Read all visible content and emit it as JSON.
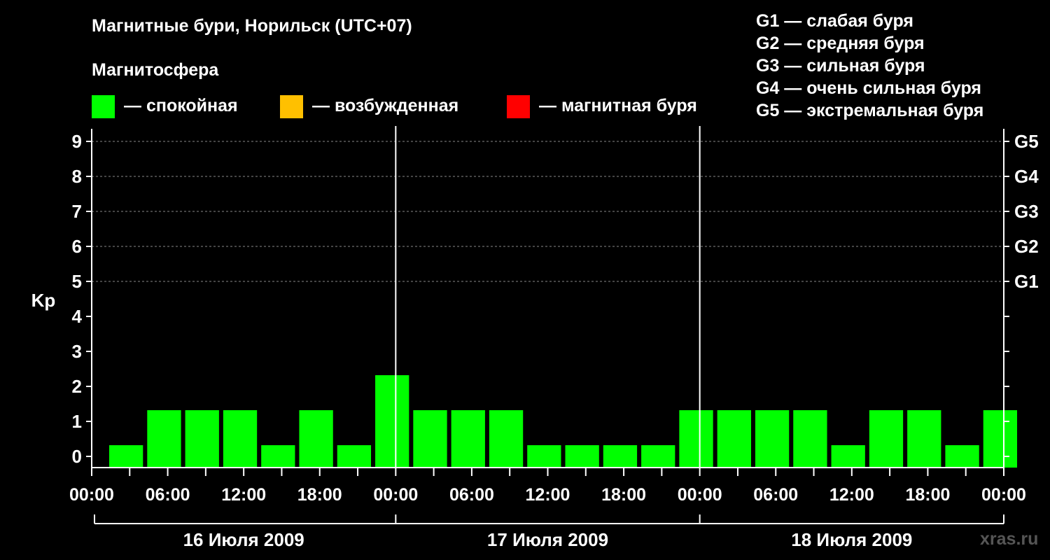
{
  "chart_data": {
    "type": "bar",
    "title": "Магнитные бури, Норильск (UTC+07)",
    "subtitle": "Магнитосфера",
    "ylabel": "Kp",
    "ylim": [
      0,
      9
    ],
    "yticks": [
      "0",
      "1",
      "2",
      "3",
      "4",
      "5",
      "6",
      "7",
      "8",
      "9"
    ],
    "right_ticks": [
      {
        "kp": 5,
        "label": "G1"
      },
      {
        "kp": 6,
        "label": "G2"
      },
      {
        "kp": 7,
        "label": "G3"
      },
      {
        "kp": 8,
        "label": "G4"
      },
      {
        "kp": 9,
        "label": "G5"
      }
    ],
    "xticks": [
      "00:00",
      "06:00",
      "12:00",
      "18:00",
      "00:00",
      "06:00",
      "12:00",
      "18:00",
      "00:00",
      "06:00",
      "12:00",
      "18:00",
      "00:00"
    ],
    "days": [
      "16 Июля 2009",
      "17 Июля 2009",
      "18 Июля 2009"
    ],
    "colors": {
      "calm": "#00ff00",
      "excited": "#ffc000",
      "storm": "#ff0000",
      "background": "#000000"
    },
    "grid": "dashed horizontal at Kp 5-9",
    "x_unit": "3-hour intervals starting 16 Июля 2009 00:00",
    "values": [
      0,
      1,
      1,
      1,
      0,
      1,
      0,
      2,
      1,
      1,
      1,
      0,
      0,
      0,
      0,
      1,
      1,
      1,
      1,
      0,
      1,
      1,
      0,
      1
    ],
    "status": [
      "calm",
      "calm",
      "calm",
      "calm",
      "calm",
      "calm",
      "calm",
      "calm",
      "calm",
      "calm",
      "calm",
      "calm",
      "calm",
      "calm",
      "calm",
      "calm",
      "calm",
      "calm",
      "calm",
      "calm",
      "calm",
      "calm",
      "calm",
      "calm"
    ]
  },
  "legend": {
    "calm": "— спокойная",
    "excited": "— возбужденная",
    "storm": "— магнитная буря"
  },
  "g_scale": [
    "G1 — слабая буря",
    "G2 — средняя буря",
    "G3 — сильная буря",
    "G4 — очень сильная буря",
    "G5 — экстремальная буря"
  ],
  "watermark": "xras.ru"
}
